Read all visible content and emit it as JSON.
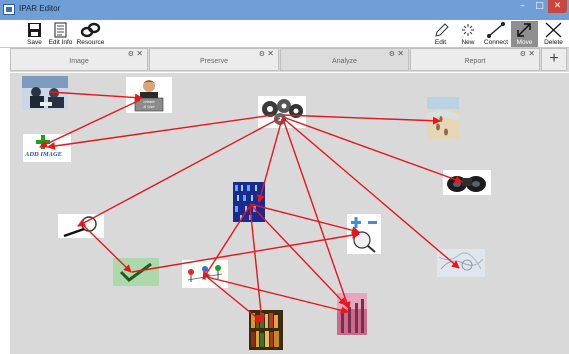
{
  "window": {
    "title": "IPAR Editor",
    "minimize": "–",
    "maximize": "□",
    "close": "✕"
  },
  "toolbar": {
    "save": "Save",
    "edit_info": "Edit Info",
    "resource": "Resource",
    "edit": "Edit",
    "new": "New",
    "connect": "Connect",
    "move": "Move",
    "delete": "Delete",
    "active_tool": "Move"
  },
  "tabs": [
    {
      "label": "Image",
      "gear": "⚙",
      "close": "✕"
    },
    {
      "label": "Preserve",
      "gear": "⚙",
      "close": "✕"
    },
    {
      "label": "Analyze",
      "gear": "⚙",
      "close": "✕"
    },
    {
      "label": "Report",
      "gear": "⚙",
      "close": "✕"
    }
  ],
  "add_tab": "+",
  "nodes": {
    "person_card": {
      "line1": "create",
      "line2": "& Use"
    },
    "add_image": {
      "text": "ADD IMAGE"
    }
  },
  "colors": {
    "link": "#e8151b",
    "active_tool_bg": "#8f8f8f",
    "canvas": "#d9d9d9"
  }
}
